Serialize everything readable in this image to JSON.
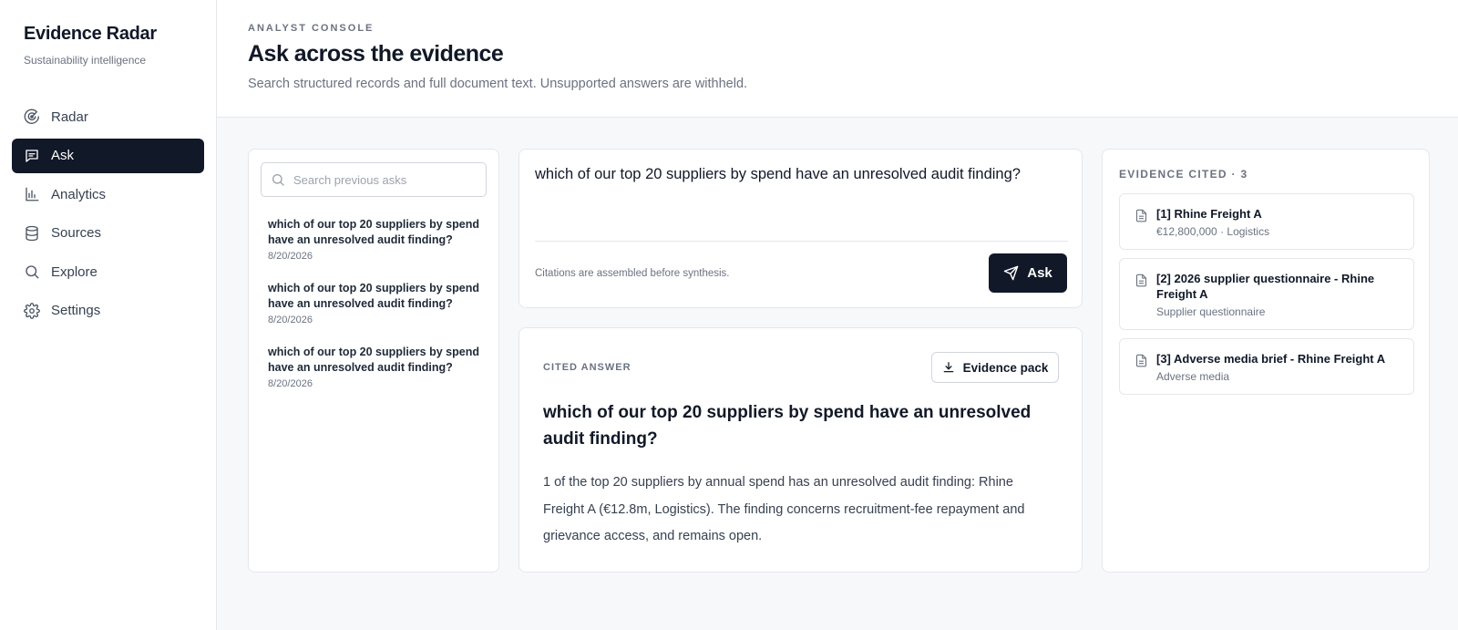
{
  "sidebar": {
    "brand_title": "Evidence Radar",
    "brand_subtitle": "Sustainability intelligence",
    "items": [
      {
        "label": "Radar",
        "icon": "radar-icon"
      },
      {
        "label": "Ask",
        "icon": "message-icon",
        "active": true
      },
      {
        "label": "Analytics",
        "icon": "bar-chart-icon"
      },
      {
        "label": "Sources",
        "icon": "database-icon"
      },
      {
        "label": "Explore",
        "icon": "search-icon"
      },
      {
        "label": "Settings",
        "icon": "gear-icon"
      }
    ]
  },
  "header": {
    "eyebrow": "ANALYST CONSOLE",
    "title": "Ask across the evidence",
    "subtitle": "Search structured records and full document text. Unsupported answers are withheld."
  },
  "history": {
    "search_placeholder": "Search previous asks",
    "items": [
      {
        "question": "which of our top 20 suppliers by spend have an unresolved audit finding?",
        "date": "8/20/2026"
      },
      {
        "question": "which of our top 20 suppliers by spend have an unresolved audit finding?",
        "date": "8/20/2026"
      },
      {
        "question": "which of our top 20 suppliers by spend have an unresolved audit finding?",
        "date": "8/20/2026"
      }
    ]
  },
  "query": {
    "value": "which of our top 20 suppliers by spend have an unresolved audit finding?",
    "note": "Citations are assembled before synthesis.",
    "ask_label": "Ask"
  },
  "answer": {
    "label": "CITED ANSWER",
    "pack_label": "Evidence pack",
    "title": "which of our top 20 suppliers by spend have an unresolved audit finding?",
    "body": "1 of the top 20 suppliers by annual spend has an unresolved audit finding: Rhine Freight A (€12.8m, Logistics). The finding concerns recruitment-fee repayment and grievance access, and remains open."
  },
  "evidence": {
    "heading": "EVIDENCE CITED · 3",
    "items": [
      {
        "title": "[1] Rhine Freight A",
        "meta": "€12,800,000 · Logistics"
      },
      {
        "title": "[2] 2026 supplier questionnaire - Rhine Freight A",
        "meta": "Supplier questionnaire"
      },
      {
        "title": "[3] Adverse media brief - Rhine Freight A",
        "meta": "Adverse media"
      }
    ]
  },
  "colors": {
    "accent_dark": "#111827",
    "background": "#f7f8fa",
    "border": "#e5e7eb",
    "muted_text": "#6b7280"
  }
}
